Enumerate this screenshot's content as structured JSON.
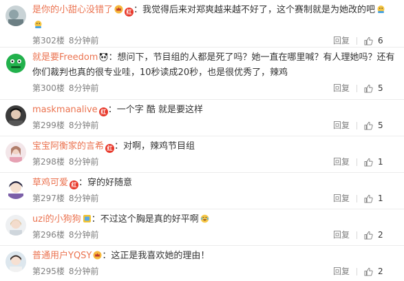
{
  "comments": [
    {
      "user": "是你的小甜心没错了",
      "badges": [
        "crown-badge",
        "red-badge"
      ],
      "text": "：我觉得后来对郑爽越来越不好了，这个赛制就是为她改的吧",
      "trailing_emoji": [
        "hands-emoji",
        "hands-emoji"
      ],
      "floor": "第302楼",
      "time": "8分钟前",
      "reply_label": "回复",
      "likes": "6"
    },
    {
      "user": "就是要Freedom",
      "badges": [
        "panda-badge"
      ],
      "text": "：想问下，节目组的人都是死了吗？她一直在哪里喊？有人理她吗？还有你们裁判也真的很专业哇，10秒读成20秒，也是很优秀了，辣鸡",
      "trailing_emoji": [],
      "floor": "第300楼",
      "time": "8分钟前",
      "reply_label": "回复",
      "likes": "5"
    },
    {
      "user": "maskmanalive",
      "badges": [
        "red-badge"
      ],
      "text": "：一个字 酷 就是要这样",
      "trailing_emoji": [],
      "floor": "第299楼",
      "time": "8分钟前",
      "reply_label": "回复",
      "likes": "5"
    },
    {
      "user": "宝宝阿衡家的言希",
      "badges": [
        "red-badge"
      ],
      "text": "：对啊，辣鸡节目组",
      "trailing_emoji": [],
      "floor": "第298楼",
      "time": "8分钟前",
      "reply_label": "回复",
      "likes": "1"
    },
    {
      "user": "草鸡可爱",
      "badges": [
        "red-badge"
      ],
      "text": "：穿的好随意",
      "trailing_emoji": [],
      "floor": "第297楼",
      "time": "8分钟前",
      "reply_label": "回复",
      "likes": "1"
    },
    {
      "user": "uzi的小狗狗",
      "badges": [
        "yellow-badge"
      ],
      "text": "：不过这个胸是真的好平啊",
      "trailing_emoji": [
        "laugh-cry-emoji"
      ],
      "floor": "第296楼",
      "time": "8分钟前",
      "reply_label": "回复",
      "likes": "2"
    },
    {
      "user": "普通用户YQSY",
      "badges": [
        "crown-badge"
      ],
      "text": "：这正是我喜欢她的理由！",
      "trailing_emoji": [],
      "floor": "第295楼",
      "time": "8分钟前",
      "reply_label": "回复",
      "likes": "2"
    }
  ],
  "colors": {
    "username": "#eb7350",
    "meta": "#808080",
    "text": "#333333"
  }
}
